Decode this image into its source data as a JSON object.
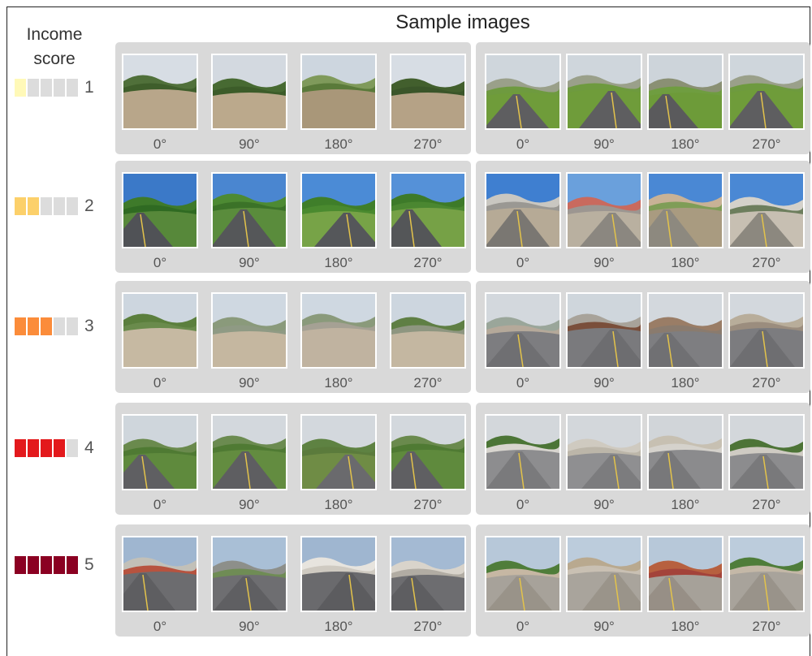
{
  "header": {
    "legend_title_line1": "Income",
    "legend_title_line2": "score",
    "sample_title": "Sample images"
  },
  "score_colors": [
    "#fff9b8",
    "#fcd06a",
    "#fb8c3a",
    "#e3191c",
    "#8b0022"
  ],
  "empty_segment_color": "#dcdcdc",
  "rows": [
    {
      "score": "1",
      "level": 1
    },
    {
      "score": "2",
      "level": 2
    },
    {
      "score": "3",
      "level": 3
    },
    {
      "score": "4",
      "level": 4
    },
    {
      "score": "5",
      "level": 5
    }
  ],
  "angles": [
    "0°",
    "90°",
    "180°",
    "270°"
  ]
}
